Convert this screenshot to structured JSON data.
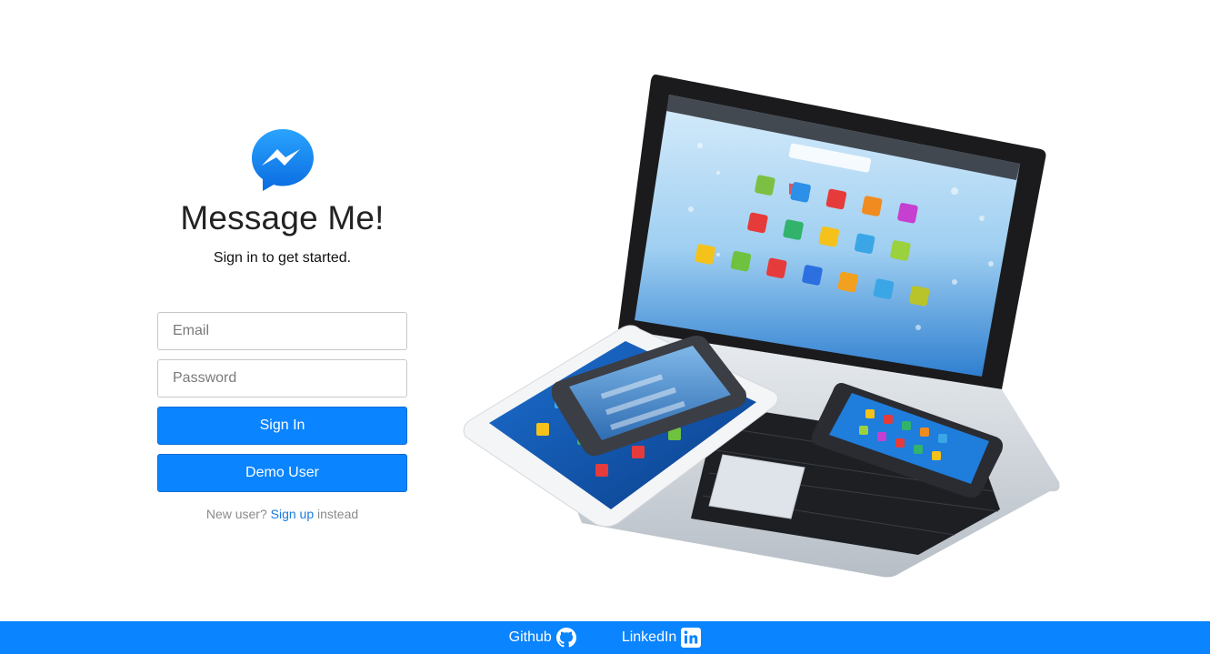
{
  "app": {
    "title": "Message Me!",
    "subtitle": "Sign in to get started."
  },
  "form": {
    "email_placeholder": "Email",
    "password_placeholder": "Password",
    "signin_label": "Sign In",
    "demo_label": "Demo User"
  },
  "signup": {
    "prefix": "New user? ",
    "link_label": "Sign up",
    "suffix": " instead"
  },
  "footer": {
    "github_label": "Github",
    "linkedin_label": "LinkedIn"
  },
  "icons": {
    "logo": "messenger-logo-icon",
    "github": "github-icon",
    "linkedin": "linkedin-icon"
  },
  "colors": {
    "accent": "#0a84ff",
    "link": "#1a7be0",
    "footer": "#0a84ff"
  }
}
